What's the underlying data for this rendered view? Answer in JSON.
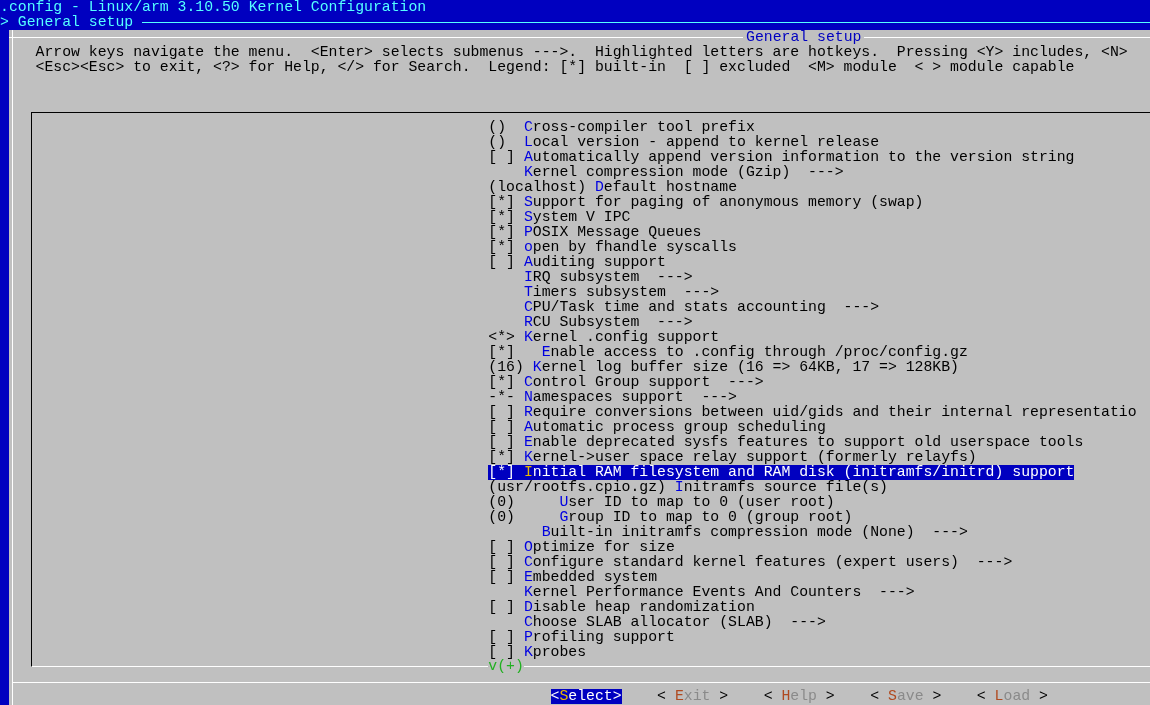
{
  "window": {
    "title": ".config - Linux/arm 3.10.50 Kernel Configuration",
    "breadcrumb": "> General setup"
  },
  "dialog": {
    "title": "General setup",
    "help_lines": [
      "Arrow keys navigate the menu.  <Enter> selects submenus --->.  Highlighted letters are hotkeys.  Pressing <Y> includes, <N>",
      "<Esc><Esc> to exit, <?> for Help, </> for Search.  Legend: [*] built-in  [ ] excluded  <M> module  < > module capable"
    ],
    "menu": {
      "scroll_indicator": "v(+)",
      "items": [
        {
          "prefix": "()",
          "label": "Cross-compiler tool prefix",
          "selected": false
        },
        {
          "prefix": "()",
          "label": "Local version - append to kernel release",
          "selected": false
        },
        {
          "prefix": "[ ]",
          "label": "Automatically append version information to the version string",
          "selected": false
        },
        {
          "label": "Kernel compression mode (Gzip)  --->",
          "selected": false
        },
        {
          "prefix": "(localhost)",
          "label": "Default hostname",
          "selected": false
        },
        {
          "prefix": "[*]",
          "label": "Support for paging of anonymous memory (swap)",
          "selected": false
        },
        {
          "prefix": "[*]",
          "label": "System V IPC",
          "selected": false
        },
        {
          "prefix": "[*]",
          "label": "POSIX Message Queues",
          "selected": false
        },
        {
          "prefix": "[*]",
          "label": "open by fhandle syscalls",
          "selected": false
        },
        {
          "prefix": "[ ]",
          "label": "Auditing support",
          "selected": false
        },
        {
          "label": "IRQ subsystem  --->",
          "selected": false
        },
        {
          "label": "Timers subsystem  --->",
          "selected": false
        },
        {
          "label": "CPU/Task time and stats accounting  --->",
          "selected": false
        },
        {
          "label": "RCU Subsystem  --->",
          "selected": false
        },
        {
          "prefix": "<*>",
          "label": "Kernel .config support",
          "selected": false,
          "children": [
            {
              "prefix": "[*]",
              "label": "Enable access to .config through /proc/config.gz",
              "selected": false
            }
          ]
        },
        {
          "prefix": "(16)",
          "label": "Kernel log buffer size (16 => 64KB, 17 => 128KB)",
          "selected": false
        },
        {
          "prefix": "[*]",
          "label": "Control Group support  --->",
          "selected": false
        },
        {
          "prefix": "-*-",
          "label": "Namespaces support  --->",
          "selected": false
        },
        {
          "prefix": "[ ]",
          "label": "Require conversions between uid/gids and their internal representatio",
          "selected": false
        },
        {
          "prefix": "[ ]",
          "label": "Automatic process group scheduling",
          "selected": false
        },
        {
          "prefix": "[ ]",
          "label": "Enable deprecated sysfs features to support old userspace tools",
          "selected": false
        },
        {
          "prefix": "[*]",
          "label": "Kernel->user space relay support (formerly relayfs)",
          "selected": false
        },
        {
          "prefix": "[*]",
          "label": "Initial RAM filesystem and RAM disk (initramfs/initrd) support",
          "selected": true,
          "children": [
            {
              "prefix": "(usr/rootfs.cpio.gz)",
              "label": "Initramfs source file(s)",
              "selected": false,
              "children": [
                {
                  "prefix": "(0)",
                  "label": "User ID to map to 0 (user root)",
                  "selected": false
                },
                {
                  "prefix": "(0)",
                  "label": "Group ID to map to 0 (group root)",
                  "selected": false
                }
              ]
            },
            {
              "label": "Built-in initramfs compression mode (None)  --->",
              "selected": false
            }
          ]
        },
        {
          "prefix": "[ ]",
          "label": "Optimize for size",
          "selected": false
        },
        {
          "prefix": "[ ]",
          "label": "Configure standard kernel features (expert users)  --->",
          "selected": false
        },
        {
          "prefix": "[ ]",
          "label": "Embedded system",
          "selected": false
        },
        {
          "label": "Kernel Performance Events And Counters  --->",
          "selected": false
        },
        {
          "prefix": "[ ]",
          "label": "Disable heap randomization",
          "selected": false
        },
        {
          "label": "Choose SLAB allocator (SLAB)  --->",
          "selected": false
        },
        {
          "prefix": "[ ]",
          "label": "Profiling support",
          "selected": false
        },
        {
          "prefix": "[ ]",
          "label": "Kprobes",
          "selected": false
        }
      ]
    },
    "buttons": [
      {
        "label": "<Select>",
        "selected": true
      },
      {
        "label": "< Exit >",
        "selected": false
      },
      {
        "label": "< Help >",
        "selected": false
      },
      {
        "label": "< Save >",
        "selected": false
      },
      {
        "label": "< Load >",
        "selected": false
      }
    ]
  }
}
